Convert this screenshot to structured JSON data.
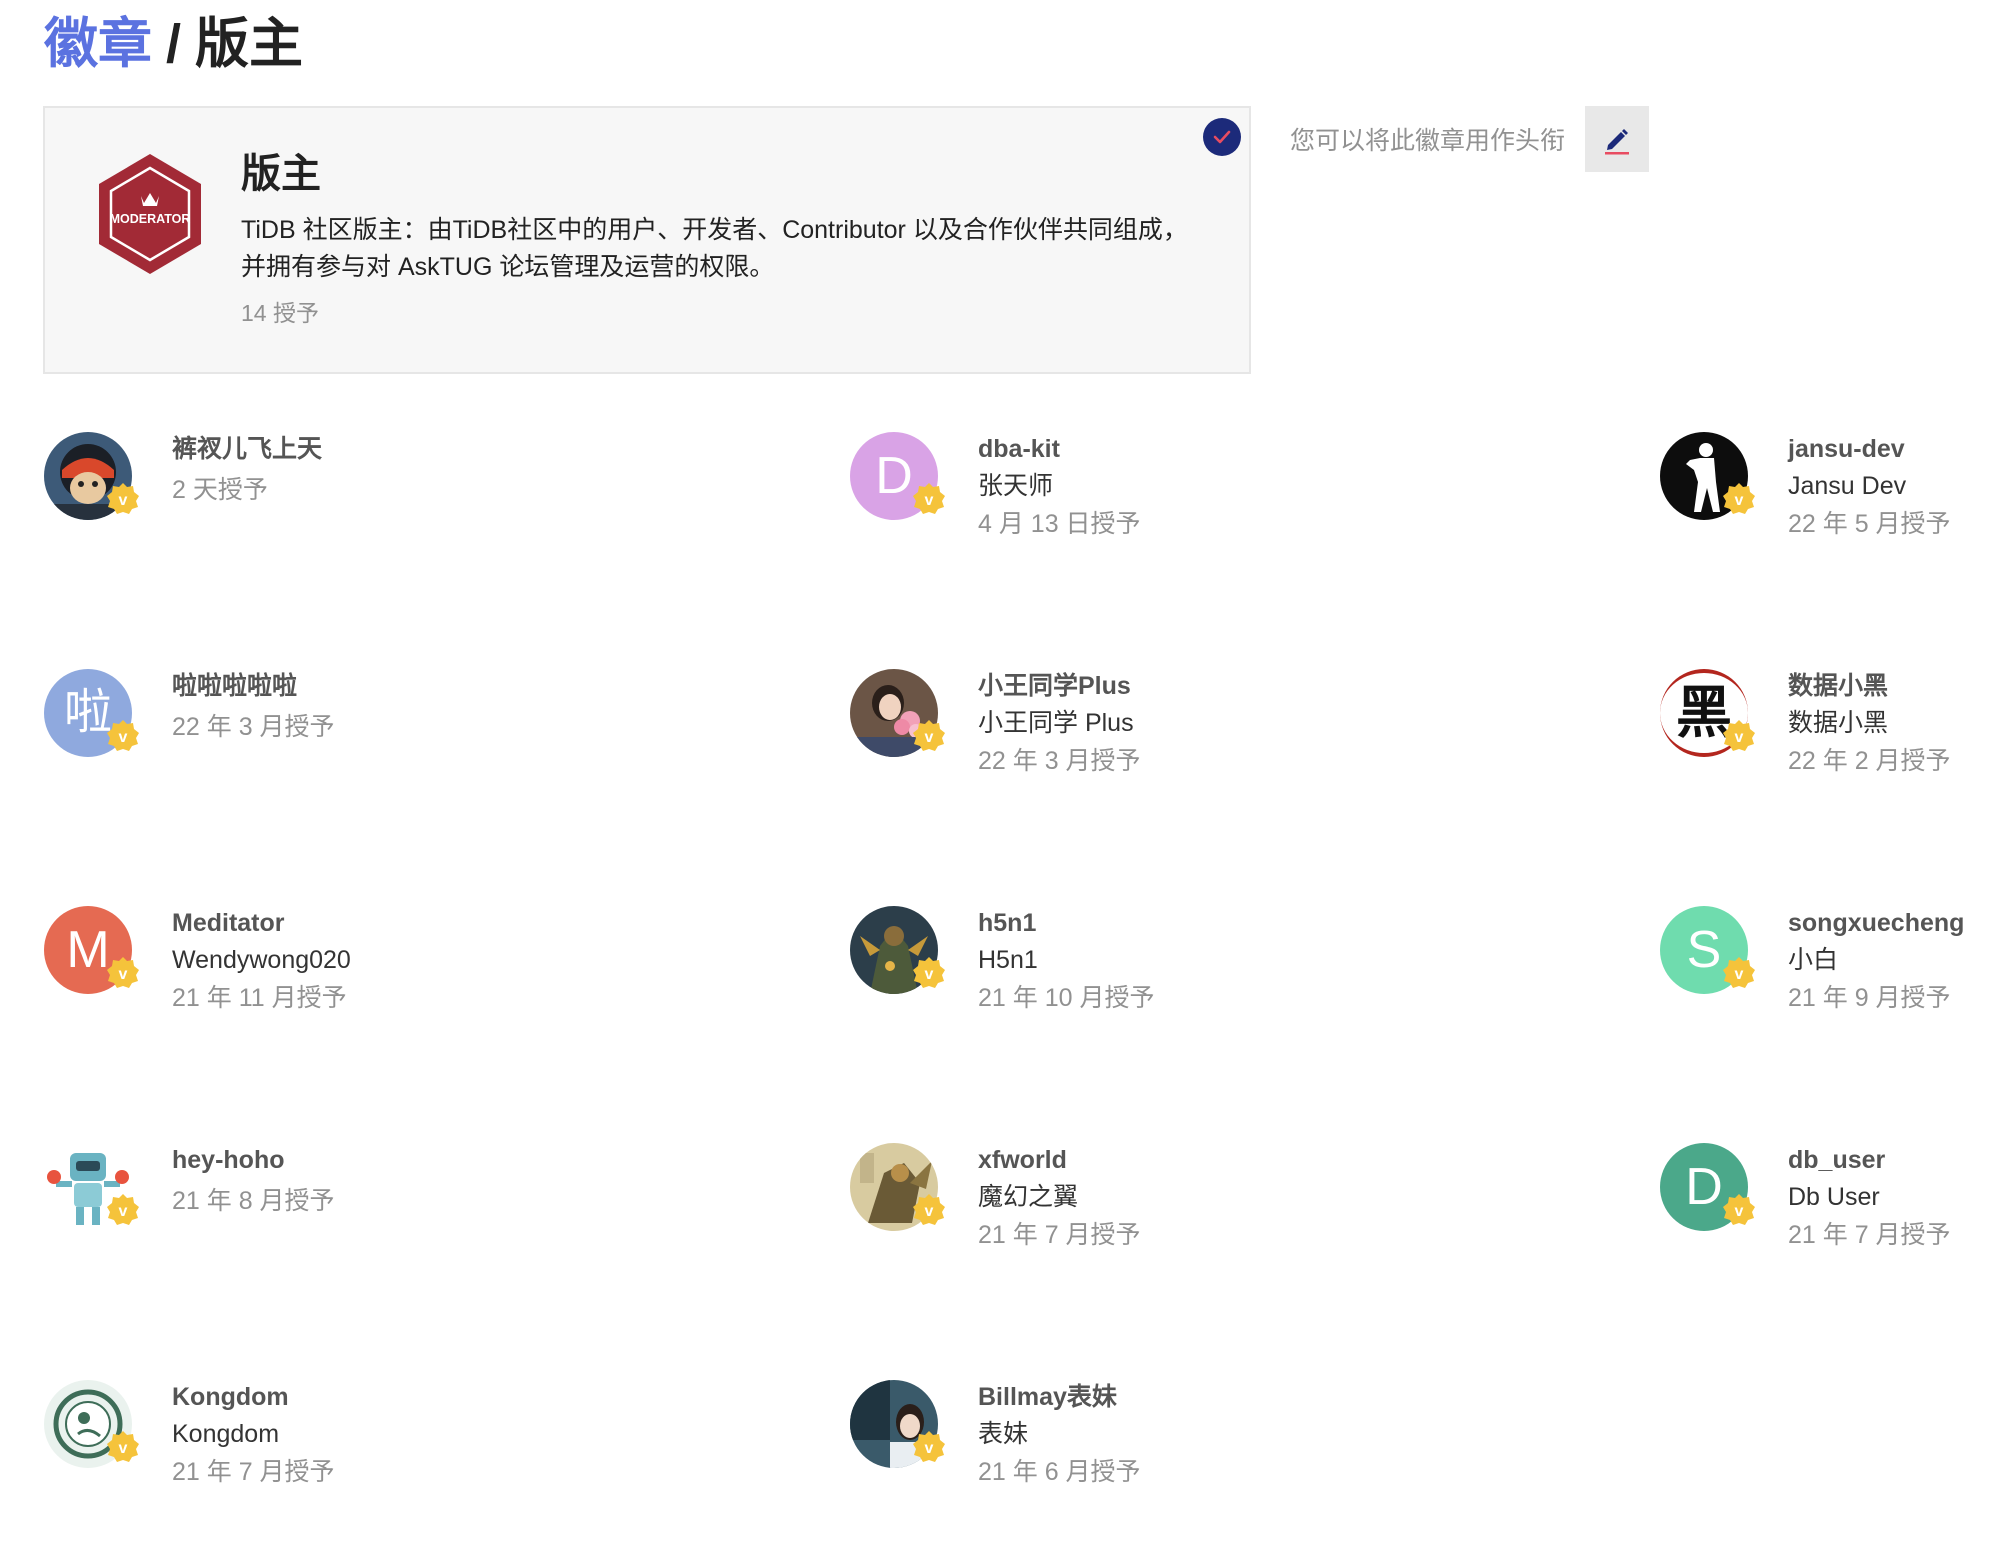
{
  "breadcrumb": {
    "link": "徽章",
    "separator": "/",
    "current": "版主"
  },
  "badge": {
    "name": "版主",
    "description": "TiDB 社区版主：由TiDB社区中的用户、开发者、Contributor 以及合作伙伴共同组成，并拥有参与对 AskTUG 论坛管理及运营的权限。",
    "granted_count": "14 授予",
    "icon_text": "MODERATOR",
    "icon": "moderator-hexagon-icon",
    "icon_color": "#a22a36",
    "granted_check_icon": "check-circle-icon"
  },
  "title_hint": "您可以将此徽章用作头衔",
  "edit_icon": "pencil-icon",
  "flair_icon": "verified-v-icon",
  "flair_text": "v",
  "users": [
    {
      "username": "裤衩儿飞上天",
      "name": "",
      "granted": "2 天授予",
      "avatar": "photo"
    },
    {
      "username": "dba-kit",
      "name": "张天师",
      "granted": "4 月 13 日授予",
      "avatar_letter": "D",
      "avatar_color": "#d9a3e6"
    },
    {
      "username": "jansu-dev",
      "name": "Jansu Dev",
      "granted": "22 年 5 月授予",
      "avatar": "photo"
    },
    {
      "username": "啦啦啦啦啦",
      "name": "",
      "granted": "22 年 3 月授予",
      "avatar_letter": "啦",
      "avatar_color": "#8fa9de"
    },
    {
      "username": "小王同学Plus",
      "name": "小王同学 Plus",
      "granted": "22 年 3 月授予",
      "avatar": "photo"
    },
    {
      "username": "数据小黑",
      "name": "数据小黑",
      "granted": "22 年 2 月授予",
      "avatar_letter": "黑",
      "avatar_color": "#ffffff"
    },
    {
      "username": "Meditator",
      "name": "Wendywong020",
      "granted": "21 年 11 月授予",
      "avatar_letter": "M",
      "avatar_color": "#e56a52"
    },
    {
      "username": "h5n1",
      "name": "H5n1",
      "granted": "21 年 10 月授予",
      "avatar": "photo"
    },
    {
      "username": "songxuecheng",
      "name": "小白",
      "granted": "21 年 9 月授予",
      "avatar_letter": "S",
      "avatar_color": "#6fdcae"
    },
    {
      "username": "hey-hoho",
      "name": "",
      "granted": "21 年 8 月授予",
      "avatar": "photo"
    },
    {
      "username": "xfworld",
      "name": "魔幻之翼",
      "granted": "21 年 7 月授予",
      "avatar": "photo"
    },
    {
      "username": "db_user",
      "name": "Db User",
      "granted": "21 年 7 月授予",
      "avatar_letter": "D",
      "avatar_color": "#4ba88a"
    },
    {
      "username": "Kongdom",
      "name": "Kongdom",
      "granted": "21 年 7 月授予",
      "avatar": "photo"
    },
    {
      "username": "Billmay表妹",
      "name": "表妹",
      "granted": "21 年 6 月授予",
      "avatar": "photo"
    }
  ]
}
